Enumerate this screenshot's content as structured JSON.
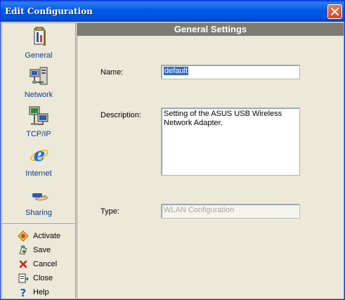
{
  "window": {
    "title": "Edit Configuration"
  },
  "sidebar": {
    "items": [
      {
        "label": "General",
        "icon": "general-settings-icon"
      },
      {
        "label": "Network",
        "icon": "network-icon"
      },
      {
        "label": "TCP/IP",
        "icon": "tcpip-icon"
      },
      {
        "label": "Internet",
        "icon": "internet-explorer-icon"
      },
      {
        "label": "Sharing",
        "icon": "sharing-icon"
      }
    ],
    "actions": [
      {
        "label": "Activate",
        "icon": "activate-icon"
      },
      {
        "label": "Save",
        "icon": "save-icon"
      },
      {
        "label": "Cancel",
        "icon": "cancel-icon"
      },
      {
        "label": "Close",
        "icon": "close-doc-icon"
      },
      {
        "label": "Help",
        "icon": "help-icon"
      }
    ]
  },
  "main": {
    "header": "General Settings",
    "name_label": "Name:",
    "name_value": "default",
    "description_label": "Description:",
    "description_value": "Setting of the ASUS USB Wireless Network Adapter.",
    "type_label": "Type:",
    "type_value": "WLAN Configuration"
  },
  "colors": {
    "titlebar": "#0058e6",
    "header_bg": "#7d7b72",
    "nav_text": "#0b3b9b",
    "selection": "#316ac5"
  }
}
